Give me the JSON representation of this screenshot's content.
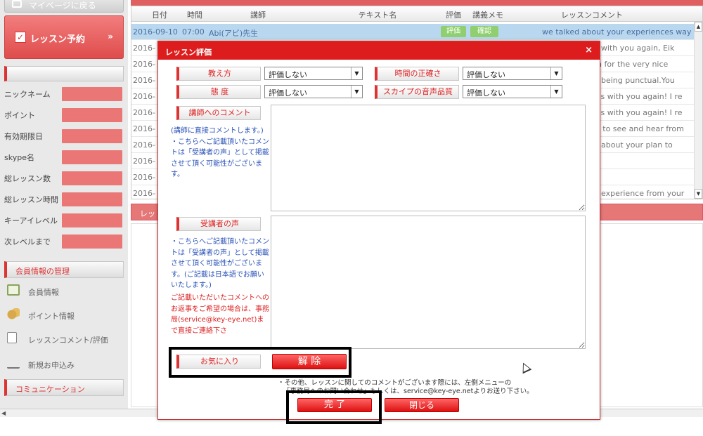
{
  "sidebar": {
    "back_label": "マイページに戻る",
    "reserve_label": "レッスン予約",
    "info_labels": [
      "ニックネーム",
      "ポイント",
      "有効期限日",
      "skype名",
      "総レッスン数",
      "総レッスン時間",
      "キーアイレベル",
      "次レベルまで"
    ],
    "member_section": "会員情報の管理",
    "menu": [
      "会員情報",
      "ポイント情報",
      "レッスンコメント/評価",
      "新規お申込み"
    ],
    "comm_section": "コミュニケーション"
  },
  "grid": {
    "headers": [
      "日付",
      "時間",
      "講師",
      "テキスト名",
      "評価",
      "講義メモ",
      "レッスンコメント"
    ],
    "selected_row": {
      "date": "2016-09-10",
      "time": "07:00",
      "teacher": "Abi(アビ)先生",
      "rate_btn": "評価",
      "memo_btn": "確認",
      "comment": "we talked about your experiences way"
    },
    "row_date_prefix": "2016-",
    "comments": [
      "lk with you again, Eik",
      "h for the very nice",
      "being punctual.You",
      "ess with you again! I re",
      "ess with you again! I re",
      "e to see and hear from",
      "about your plan to",
      "",
      "",
      "r experience from your"
    ]
  },
  "section2_label": "レッ",
  "modal": {
    "title": "レッスン評価",
    "close": "×",
    "teaching_label": "教え方",
    "attitude_label": "態 度",
    "punctuality_label": "時間の正確さ",
    "skype_label": "スカイプの音声品質",
    "select_value": "評価しない",
    "teacher_comment_label": "講師へのコメント",
    "teacher_note": "(講師に直接コメントします。)\n・こちらへご記載頂いたコメントは「受講者の声」として掲載させて頂く可能性がございます。",
    "student_voice_label": "受講者の声",
    "student_note": "・こちらへご記載頂いたコメントは「受講者の声」として掲載させて頂く可能性がございます。(ご記載は日本語でお願いいたします。)",
    "student_note_red": "ご記載いただいたコメントへのお返事をご希望の場合は、事務局(service@key-eye.net)まで直接ご連絡下さ",
    "favorite_label": "お気に入り",
    "release_btn": "解 除",
    "footer_line1": "・その他、レッスンに関してのコメントがございます際には、左側メニューの",
    "footer_line2": "「事務局へのお問い合わせ」もしくは、service@key-eye.netよりお送り下さい。",
    "complete_btn": "完 了",
    "close_btn": "閉じる"
  }
}
